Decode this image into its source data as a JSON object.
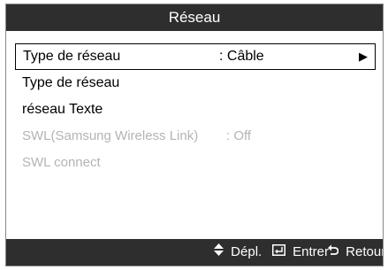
{
  "window": {
    "title": "Réseau"
  },
  "menu": {
    "items": [
      {
        "label": "Type de réseau",
        "value": ": Câble",
        "arrow": "▶",
        "selected": true,
        "disabled": false
      },
      {
        "label": "Type de réseau",
        "selected": false,
        "disabled": false
      },
      {
        "label": "réseau Texte",
        "selected": false,
        "disabled": false
      },
      {
        "label": "SWL(Samsung Wireless Link)",
        "value": ": Off",
        "selected": false,
        "disabled": true
      },
      {
        "label": "SWL connect",
        "selected": false,
        "disabled": true
      }
    ]
  },
  "footer": {
    "move_icon": "up-down-arrow-icon",
    "move_label": "Dépl.",
    "enter_icon": "enter-icon",
    "enter_label": "Entrer",
    "return_icon": "return-icon",
    "return_label": "Retour"
  },
  "colors": {
    "bar_bg": "#2e2e2e",
    "disabled_text": "#b4b4b4",
    "text": "#000000"
  }
}
